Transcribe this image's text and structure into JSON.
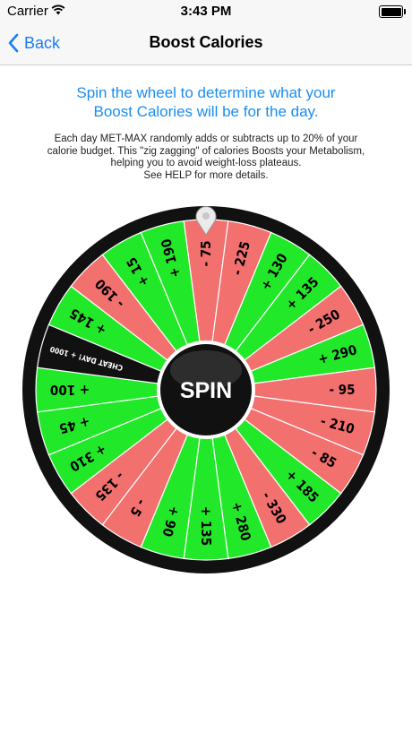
{
  "status_bar": {
    "carrier": "Carrier",
    "time": "3:43 PM"
  },
  "nav": {
    "back_label": "Back",
    "title": "Boost Calories"
  },
  "instruction": {
    "line1": "Spin the wheel to determine what your",
    "line2": "Boost Calories will be for the day."
  },
  "description": {
    "line1": "Each day MET-MAX randomly adds or subtracts up to 20% of your",
    "line2": "calorie budget.  This \"zig zagging\" of calories Boosts your Metabolism,",
    "line3": "helping you to avoid weight-loss plateaus.",
    "line4": "See HELP for more details."
  },
  "colors": {
    "green": "#22e82a",
    "red": "#f2706e",
    "black": "#111111",
    "accent": "#1a7cf5"
  },
  "wheel": {
    "spin_label": "SPIN",
    "segments": [
      {
        "label": "- 75",
        "type": "red"
      },
      {
        "label": "- 225",
        "type": "red"
      },
      {
        "label": "+ 130",
        "type": "green"
      },
      {
        "label": "+ 135",
        "type": "green"
      },
      {
        "label": "- 250",
        "type": "red"
      },
      {
        "label": "+ 290",
        "type": "green"
      },
      {
        "label": "- 95",
        "type": "red"
      },
      {
        "label": "- 210",
        "type": "red"
      },
      {
        "label": "- 85",
        "type": "red"
      },
      {
        "label": "+ 185",
        "type": "green"
      },
      {
        "label": "- 330",
        "type": "red"
      },
      {
        "label": "+ 280",
        "type": "green"
      },
      {
        "label": "+ 135",
        "type": "green"
      },
      {
        "label": "+ 90",
        "type": "green"
      },
      {
        "label": "- 5",
        "type": "red"
      },
      {
        "label": "- 135",
        "type": "red"
      },
      {
        "label": "+ 310",
        "type": "green"
      },
      {
        "label": "+ 45",
        "type": "green"
      },
      {
        "label": "+ 100",
        "type": "green"
      },
      {
        "label": "CHEAT DAY! + 1000",
        "type": "black"
      },
      {
        "label": "+ 145",
        "type": "green"
      },
      {
        "label": "- 190",
        "type": "red"
      },
      {
        "label": "+ 15",
        "type": "green"
      },
      {
        "label": "+ 190",
        "type": "green"
      }
    ]
  }
}
